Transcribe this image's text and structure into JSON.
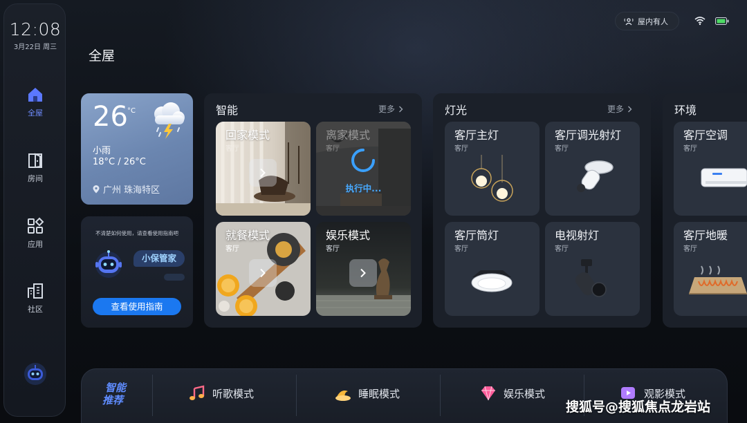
{
  "status": {
    "time": "12:08",
    "date": "3月22日 周三",
    "presence": "屋内有人",
    "wifi_icon": "wifi-icon",
    "battery_icon": "battery-icon",
    "battery_color": "#4cd964"
  },
  "sidebar": {
    "items": [
      {
        "label": "全屋",
        "icon": "home-icon",
        "active": true
      },
      {
        "label": "房间",
        "icon": "door-icon",
        "active": false
      },
      {
        "label": "应用",
        "icon": "apps-icon",
        "active": false
      },
      {
        "label": "社区",
        "icon": "building-icon",
        "active": false
      }
    ],
    "assistant_icon": "robot-icon",
    "accent": "#6f8dff"
  },
  "page": {
    "title": "全屋"
  },
  "weather": {
    "temperature": "26",
    "unit": "°C",
    "condition": "小雨",
    "range": "18°C / 26°C",
    "location": "广州 珠海特区",
    "icon": "thunderstorm-cloud-icon"
  },
  "assistant": {
    "tip": "不清楚如何使用，请查看使用指南吧",
    "name": "小保管家",
    "button": "查看使用指南"
  },
  "smart": {
    "title": "智能",
    "more": "更多",
    "scenes": [
      {
        "name": "回家模式",
        "room": "客厅",
        "state": ""
      },
      {
        "name": "离家模式",
        "room": "客厅",
        "state": "执行中..."
      },
      {
        "name": "就餐模式",
        "room": "客厅",
        "state": ""
      },
      {
        "name": "娱乐模式",
        "room": "客厅",
        "state": ""
      }
    ]
  },
  "lighting": {
    "title": "灯光",
    "more": "更多",
    "devices": [
      {
        "name": "客厅主灯",
        "room": "客厅",
        "icon": "pendant-lamp-icon"
      },
      {
        "name": "客厅调光射灯",
        "room": "客厅",
        "icon": "spotlight-icon"
      },
      {
        "name": "客厅筒灯",
        "room": "客厅",
        "icon": "downlight-icon"
      },
      {
        "name": "电视射灯",
        "room": "客厅",
        "icon": "track-light-icon"
      }
    ]
  },
  "environment": {
    "title": "环境",
    "devices": [
      {
        "name": "客厅空调",
        "room": "客厅",
        "icon": "air-conditioner-icon"
      },
      {
        "name": "客厅地暖",
        "room": "客厅",
        "icon": "floor-heating-icon"
      }
    ]
  },
  "recommend": {
    "logo": "智能推荐",
    "modes": [
      {
        "label": "听歌模式",
        "icon": "music-note-icon"
      },
      {
        "label": "睡眠模式",
        "icon": "moon-icon"
      },
      {
        "label": "娱乐模式",
        "icon": "gem-icon"
      },
      {
        "label": "观影模式",
        "icon": "video-icon"
      }
    ]
  },
  "watermark": "搜狐号@搜狐焦点龙岩站"
}
